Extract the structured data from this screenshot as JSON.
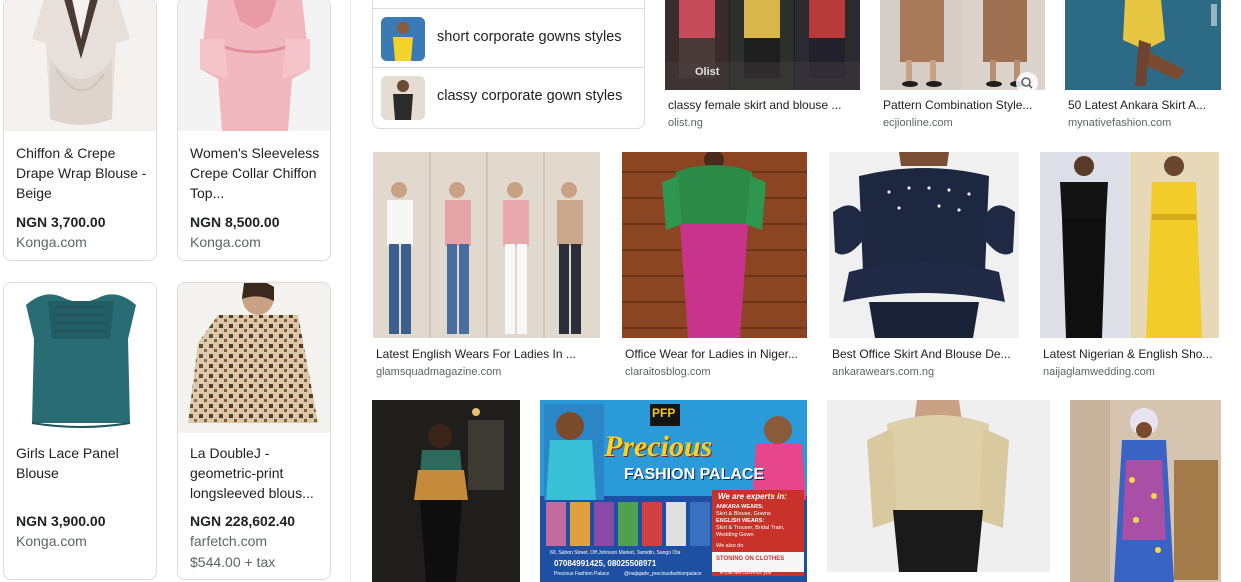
{
  "products": [
    {
      "title": "Chiffon & Crepe Drape Wrap Blouse - Beige",
      "price": "NGN 3,700.00",
      "store": "Konga.com",
      "extra": ""
    },
    {
      "title": "Women's Sleeveless Crepe Collar Chiffon Top...",
      "price": "NGN 8,500.00",
      "store": "Konga.com",
      "extra": ""
    },
    {
      "title": "Girls Lace Panel Blouse",
      "price": "NGN 3,900.00",
      "store": "Konga.com",
      "extra": ""
    },
    {
      "title": "La DoubleJ - geometric-print longsleeved blous...",
      "price": "NGN 228,602.40",
      "store": "farfetch.com",
      "extra": "$544.00 + tax"
    }
  ],
  "related": [
    {
      "label": "short corporate gowns styles"
    },
    {
      "label": "classy corporate gown styles"
    }
  ],
  "results": [
    {
      "title": "classy female skirt and blouse ...",
      "source": "olist.ng",
      "watermark": "Olist"
    },
    {
      "title": "Pattern Combination Style...",
      "source": "ecjionline.com"
    },
    {
      "title": "50 Latest Ankara Skirt A...",
      "source": "mynativefashion.com"
    },
    {
      "title": "Latest English Wears For Ladies In ...",
      "source": "glamsquadmagazine.com"
    },
    {
      "title": "Office Wear for Ladies in Niger...",
      "source": "claraitosblog.com"
    },
    {
      "title": "Best Office Skirt And Blouse De...",
      "source": "ankarawears.com.ng"
    },
    {
      "title": "Latest Nigerian & English Sho...",
      "source": "naijaglamwedding.com"
    }
  ],
  "poster": {
    "logo": "PFP",
    "title": "Precious",
    "subtitle": "FASHION PALACE",
    "experts_heading": "We are experts in:",
    "services": [
      "ANKARA WEARS:",
      "Skirt & Blouse, Gowns",
      "ENGLISH WEARS:",
      "Skirt & Trouser, Bridal Train,",
      "Wedding Gown"
    ],
    "also": "We also do",
    "stoning": "STONING ON CLOTHES",
    "address": "60, Sabon Street, Off Johnson Market, Tamidin, Sango Ota",
    "phone": "07084991425, 08025508971",
    "social": "Precious Fashion Palace",
    "instagram": "@naijajade_preciousfashionpalace",
    "trial": "A trial will convince you"
  },
  "colors": {
    "text": "#202124",
    "secondary": "#5f6368",
    "border": "#dadce0"
  }
}
